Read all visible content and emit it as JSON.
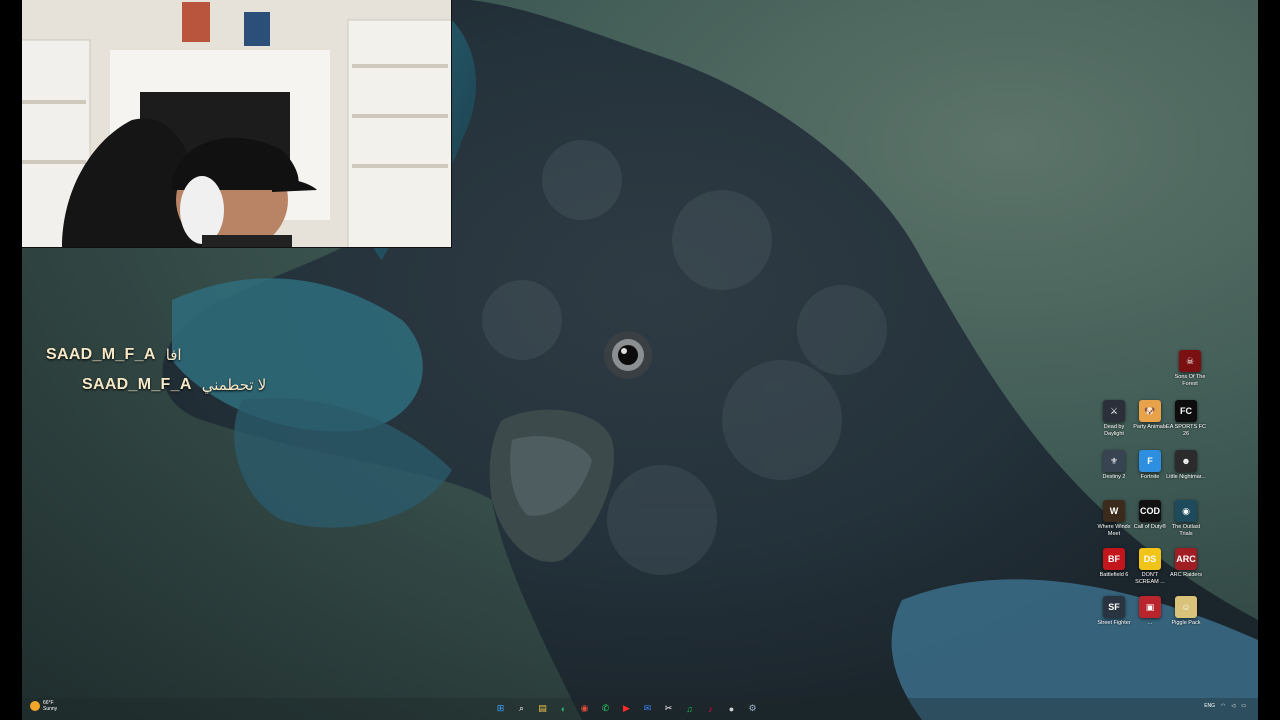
{
  "chat": {
    "messages": [
      {
        "user": "SAAD_M_F_A",
        "text": "افا"
      },
      {
        "user": "SAAD_M_F_A",
        "text": "لا تحطمني"
      }
    ]
  },
  "desktop_icons": [
    {
      "label": "Sons Of The Forest",
      "color": "#7a1012",
      "glyph": "☠",
      "icon": "sons-of-the-forest-icon"
    },
    {
      "label": "Dead by Daylight",
      "color": "#2a2f3a",
      "glyph": "⚔",
      "icon": "dead-by-daylight-icon"
    },
    {
      "label": "Party Animals",
      "color": "#e8a24a",
      "glyph": "🐶",
      "icon": "party-animals-icon"
    },
    {
      "label": "EA SPORTS FC 26",
      "color": "#0d0d0d",
      "glyph": "FC",
      "icon": "ea-sports-fc-icon"
    },
    {
      "label": "Destiny 2",
      "color": "#384452",
      "glyph": "⚜",
      "icon": "destiny-2-icon"
    },
    {
      "label": "Fortnite",
      "color": "#2e8fe0",
      "glyph": "F",
      "icon": "fortnite-icon"
    },
    {
      "label": "Little Nightmar...",
      "color": "#2b2b2b",
      "glyph": "☻",
      "icon": "little-nightmares-icon"
    },
    {
      "label": "Where Winds Meet",
      "color": "#3a2b1c",
      "glyph": "W",
      "icon": "where-winds-meet-icon"
    },
    {
      "label": "Call of Duty®",
      "color": "#111111",
      "glyph": "COD",
      "icon": "call-of-duty-icon"
    },
    {
      "label": "The Outlast Trials",
      "color": "#1d4b5c",
      "glyph": "◉",
      "icon": "outlast-trials-icon"
    },
    {
      "label": "Battlefield 6",
      "color": "#c3161c",
      "glyph": "BF",
      "icon": "battlefield-6-icon"
    },
    {
      "label": "DON'T SCREAM ...",
      "color": "#f0c419",
      "glyph": "DS",
      "icon": "dont-scream-icon"
    },
    {
      "label": "ARC Raiders",
      "color": "#a01d24",
      "glyph": "ARC",
      "icon": "arc-raiders-icon"
    },
    {
      "label": "Street Fighter",
      "color": "#2a3340",
      "glyph": "SF",
      "icon": "street-fighter-icon"
    },
    {
      "label": "...",
      "color": "#b8252d",
      "glyph": "▣",
      "icon": "game-icon"
    },
    {
      "label": "Piggle Pack",
      "color": "#d9c27a",
      "glyph": "☺",
      "icon": "piggle-pack-icon"
    }
  ],
  "taskbar": {
    "weather": {
      "temp": "66°F",
      "condition": "Sunny"
    },
    "apps": [
      {
        "icon": "windows-start-icon",
        "glyph": "⊞",
        "color": "#3aa0ff"
      },
      {
        "icon": "search-icon",
        "glyph": "⌕",
        "color": "#ffffff"
      },
      {
        "icon": "file-explorer-icon",
        "glyph": "▤",
        "color": "#f3c44a"
      },
      {
        "icon": "edge-browser-icon",
        "glyph": "◐",
        "color": "#2fb67a"
      },
      {
        "icon": "chrome-icon",
        "glyph": "◉",
        "color": "#e24c3b"
      },
      {
        "icon": "whatsapp-icon",
        "glyph": "✆",
        "color": "#25d366"
      },
      {
        "icon": "youtube-icon",
        "glyph": "▶",
        "color": "#ff2a2a"
      },
      {
        "icon": "mail-icon",
        "glyph": "✉",
        "color": "#3b82f6"
      },
      {
        "icon": "capcut-icon",
        "glyph": "✂",
        "color": "#ffffff"
      },
      {
        "icon": "spotify-icon",
        "glyph": "♫",
        "color": "#1db954"
      },
      {
        "icon": "tiktok-icon",
        "glyph": "♪",
        "color": "#ff0050"
      },
      {
        "icon": "obs-icon",
        "glyph": "●",
        "color": "#d0d0d0"
      },
      {
        "icon": "steam-icon",
        "glyph": "⚙",
        "color": "#9fb6d0"
      }
    ],
    "tray": {
      "lang": "ENG"
    }
  }
}
